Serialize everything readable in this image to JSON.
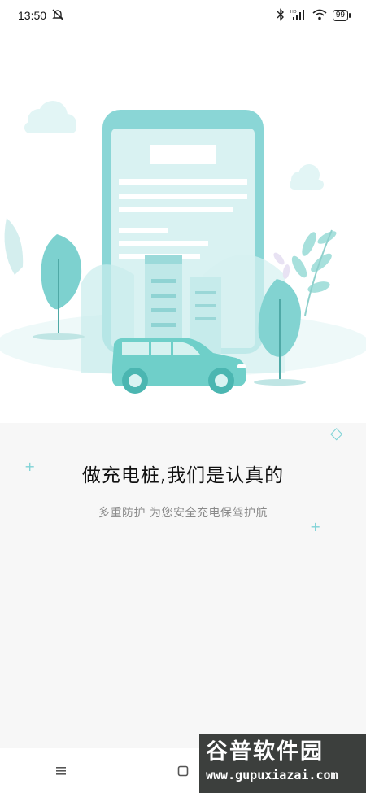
{
  "status_bar": {
    "time": "13:50",
    "battery": "99",
    "icons": [
      "mute-icon",
      "bluetooth-icon",
      "cellular-hd-icon",
      "wifi-icon",
      "battery-icon"
    ]
  },
  "onboarding": {
    "headline": "做充电桩,我们是认真的",
    "subline": "多重防护 为您安全充电保驾护航"
  },
  "nav_bar": {
    "buttons": [
      "menu-icon",
      "home-icon",
      "back-icon"
    ]
  },
  "watermark": {
    "title": "谷普软件园",
    "url": "www.gupuxiazai.com"
  },
  "colors": {
    "accent": "#6dcbcb",
    "accent_light": "#cfeff0",
    "text_primary": "#111111",
    "text_secondary": "#8a8a8a"
  }
}
